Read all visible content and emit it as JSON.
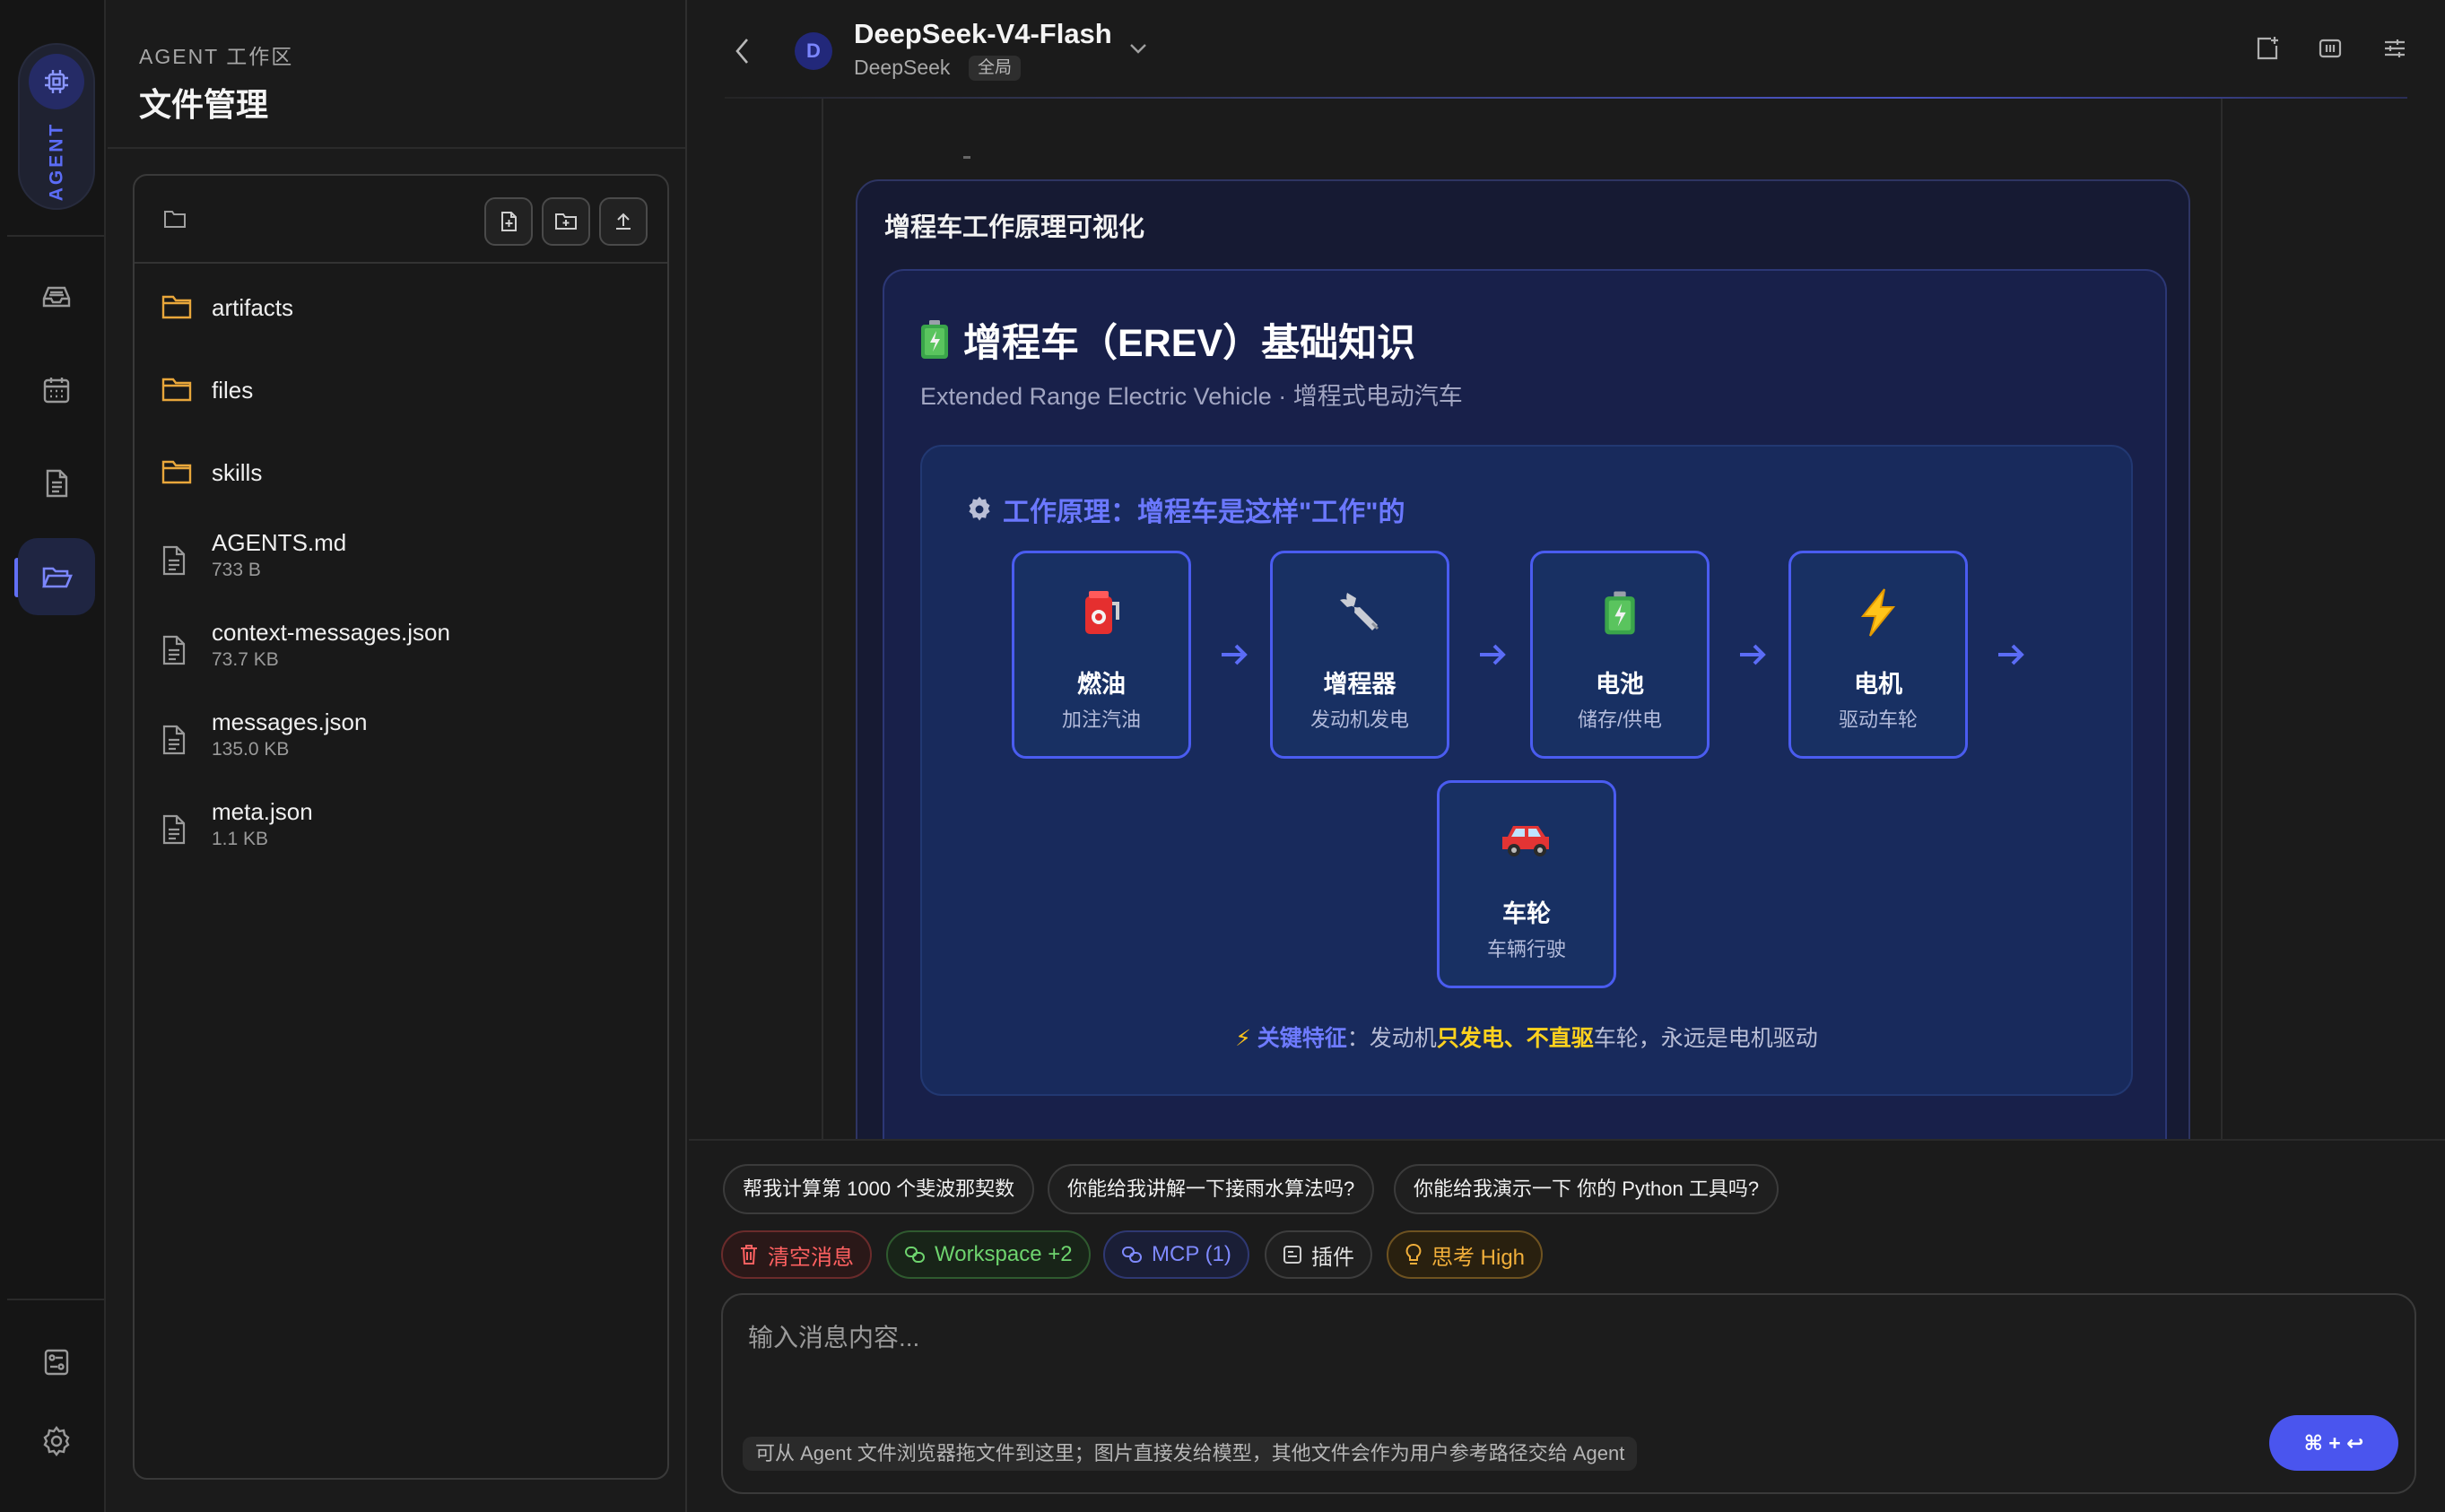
{
  "rail": {
    "agent_label": "AGENT",
    "accent": "#5b6cf6",
    "items": [
      {
        "name": "inbox-icon"
      },
      {
        "name": "calendar-icon"
      },
      {
        "name": "document-icon"
      },
      {
        "name": "folder-open-icon",
        "active": true
      }
    ],
    "bottom": [
      {
        "name": "panel-settings-icon"
      },
      {
        "name": "gear-icon"
      }
    ]
  },
  "files_panel": {
    "subtitle": "AGENT 工作区",
    "title": "文件管理",
    "toolbar": [
      "new-file-icon",
      "new-folder-icon",
      "upload-icon"
    ],
    "items": [
      {
        "type": "folder",
        "name": "artifacts"
      },
      {
        "type": "folder",
        "name": "files"
      },
      {
        "type": "folder",
        "name": "skills"
      },
      {
        "type": "file",
        "name": "AGENTS.md",
        "size": "733 B"
      },
      {
        "type": "file",
        "name": "context-messages.json",
        "size": "73.7 KB"
      },
      {
        "type": "file",
        "name": "messages.json",
        "size": "135.0 KB"
      },
      {
        "type": "file",
        "name": "meta.json",
        "size": "1.1 KB"
      }
    ]
  },
  "header": {
    "avatar_letter": "D",
    "model_name": "DeepSeek-V4-Flash",
    "provider": "DeepSeek",
    "scope": "全局"
  },
  "viz": {
    "card_title": "增程车工作原理可视化",
    "title": "增程车（EREV）基础知识",
    "subtitle": "Extended Range Electric Vehicle · 增程式电动汽车",
    "principle_title": "工作原理：增程车是这样\"工作\"的",
    "nodes": [
      {
        "icon": "fuel-pump-icon",
        "title": "燃油",
        "desc": "加注汽油"
      },
      {
        "icon": "wrench-icon",
        "title": "增程器",
        "desc": "发动机发电"
      },
      {
        "icon": "battery-icon",
        "title": "电池",
        "desc": "储存/供电"
      },
      {
        "icon": "lightning-icon",
        "title": "电机",
        "desc": "驱动车轮"
      },
      {
        "icon": "car-icon",
        "title": "车轮",
        "desc": "车辆行驶"
      }
    ],
    "key": {
      "label": "关键特征",
      "colon": "：",
      "p1": "发动机",
      "h1": "只发电",
      "sep": "、",
      "h2": "不直驱",
      "p2": "车轮，永远是电机驱动"
    },
    "colors": {
      "highlight": "#ffd21e",
      "accent": "#6b78ff",
      "node_border": "#4a5cf0"
    }
  },
  "composer": {
    "suggestions": [
      "帮我计算第 1000 个斐波那契数",
      "你能给我讲解一下接雨水算法吗?",
      "你能给我演示一下 你的 Python 工具吗?"
    ],
    "chips": {
      "clear": "清空消息",
      "workspace": "Workspace +2",
      "mcp": "MCP (1)",
      "plugins": "插件",
      "thinking": "思考 High"
    },
    "placeholder": "输入消息内容...",
    "hint": "可从 Agent 文件浏览器拖文件到这里；图片直接发给模型，其他文件会作为用户参考路径交给 Agent",
    "send_label": "⌘ + ↩"
  }
}
